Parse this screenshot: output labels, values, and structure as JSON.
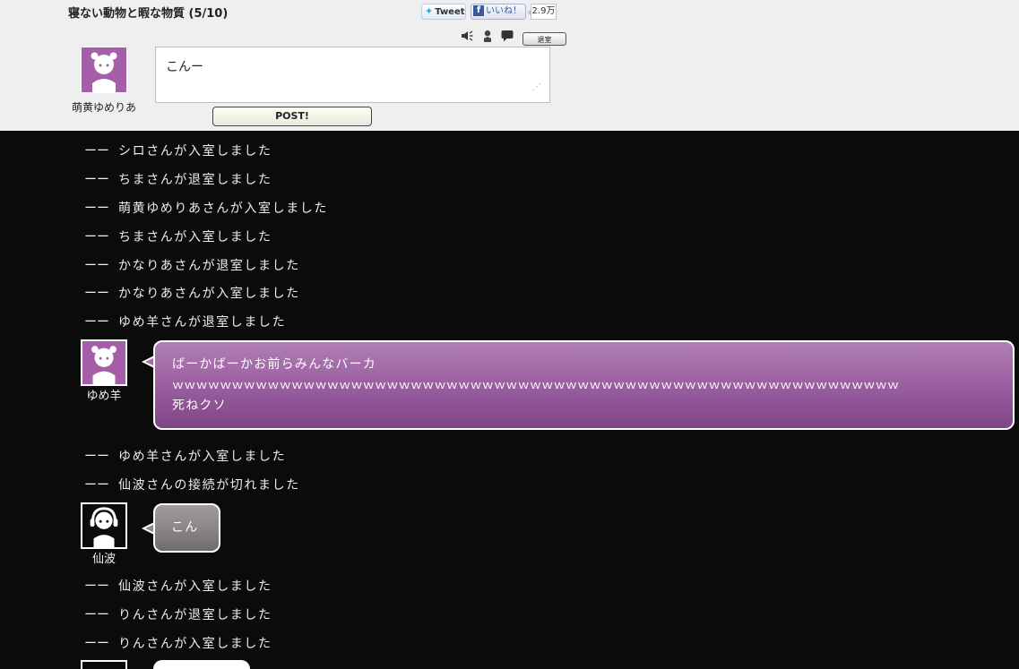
{
  "room": {
    "title": "寝ない動物と暇な物質 (5/10)"
  },
  "social": {
    "tweet_label": "Tweet",
    "like_label": "いいね！",
    "like_count": "2.9万"
  },
  "toolbar": {
    "icons": [
      "speaker-icon",
      "user-icon",
      "speech-bubble-icon"
    ],
    "leave_label": "退室"
  },
  "composer": {
    "user_name": "萌黄ゆめりあ",
    "input_value": "こんー",
    "post_label": "POST!"
  },
  "colors": {
    "header_bg": "#efefef",
    "log_bg": "#0b0b0b",
    "purple_bubble": "#9d62a3",
    "grey_bubble": "#8b8787"
  },
  "log": {
    "dash": "ーー",
    "system_top": [
      "シロさんが入室しました",
      "ちまさんが退室しました",
      "萌黄ゆめりあさんが入室しました",
      "ちまさんが入室しました",
      "かなりあさんが退室しました",
      "かなりあさんが入室しました",
      "ゆめ羊さんが退室しました"
    ],
    "message1": {
      "user": "ゆめ羊",
      "line1": "ばーかばーかお前らみんなバーカ",
      "line2": "ｗｗｗｗｗｗｗｗｗｗｗｗｗｗｗｗｗｗｗｗｗｗｗｗｗｗｗｗｗｗｗｗｗｗｗｗｗｗｗｗｗｗｗｗｗｗｗｗｗｗｗｗｗｗｗｗｗｗｗｗｗ",
      "line3": "死ねクソ"
    },
    "system_mid": [
      "ゆめ羊さんが入室しました",
      "仙波さんの接続が切れました"
    ],
    "message2": {
      "user": "仙波",
      "text": "こん"
    },
    "system_bottom": [
      "仙波さんが入室しました",
      "りんさんが退室しました",
      "りんさんが入室しました"
    ]
  }
}
